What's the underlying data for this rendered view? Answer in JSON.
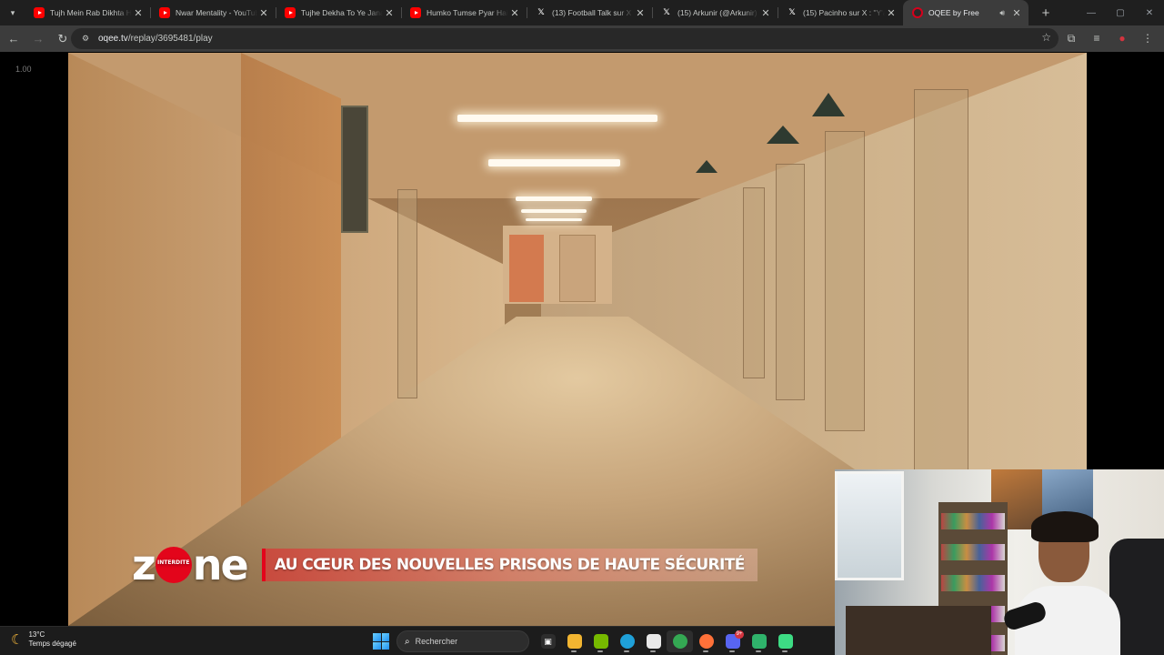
{
  "browser": {
    "tabs": [
      {
        "title": "Tujh Mein Rab Dikhta Ha",
        "favicon": "youtube-icon",
        "active": false
      },
      {
        "title": "Nwar Mentality - YouTub",
        "favicon": "youtube-icon",
        "active": false
      },
      {
        "title": "Tujhe Dekha To Ye Jana s",
        "favicon": "youtube-icon",
        "active": false
      },
      {
        "title": "Humko Tumse Pyar Hai (",
        "favicon": "youtube-icon",
        "active": false
      },
      {
        "title": "(13) Football Talk sur X : \"",
        "favicon": "x-icon",
        "active": false
      },
      {
        "title": "(15) Arkunir (@Arkunir) /",
        "favicon": "x-icon",
        "active": false
      },
      {
        "title": "(15) Pacinho sur X : \"Y'a 1",
        "favicon": "x-icon",
        "active": false
      },
      {
        "title": "OQEE by Free",
        "favicon": "oqee-icon",
        "active": true,
        "playing_audio": true
      }
    ],
    "url_host": "oqee.tv",
    "url_path": "/replay/3695481/play"
  },
  "player": {
    "speed_label": "1.00",
    "show_logo_prefix": "z",
    "show_logo_badge": "INTERDITE",
    "show_logo_suffix": "ne",
    "banner_title": "AU CŒUR DES NOUVELLES PRISONS DE HAUTE SÉCURITÉ"
  },
  "taskbar": {
    "weather_temp": "13°C",
    "weather_desc": "Temps dégagé",
    "search_placeholder": "Rechercher",
    "apps": [
      {
        "name": "task-view",
        "label": "▣",
        "color": "#2d2d2d"
      },
      {
        "name": "file-explorer",
        "label": "",
        "color": "#f2b531"
      },
      {
        "name": "nvidia",
        "label": "",
        "color": "#76b900"
      },
      {
        "name": "edge",
        "label": "",
        "color": "#1fa0d8"
      },
      {
        "name": "microsoft-store",
        "label": "",
        "color": "#e8e8e8"
      },
      {
        "name": "chrome",
        "label": "",
        "color": "#34a853"
      },
      {
        "name": "firefox",
        "label": "",
        "color": "#ff7139"
      },
      {
        "name": "discord",
        "label": "",
        "color": "#5865f2",
        "badge": "9+"
      },
      {
        "name": "xbox-gamebar",
        "label": "",
        "color": "#2fb36b"
      },
      {
        "name": "android-app",
        "label": "",
        "color": "#3ddc84"
      }
    ]
  }
}
